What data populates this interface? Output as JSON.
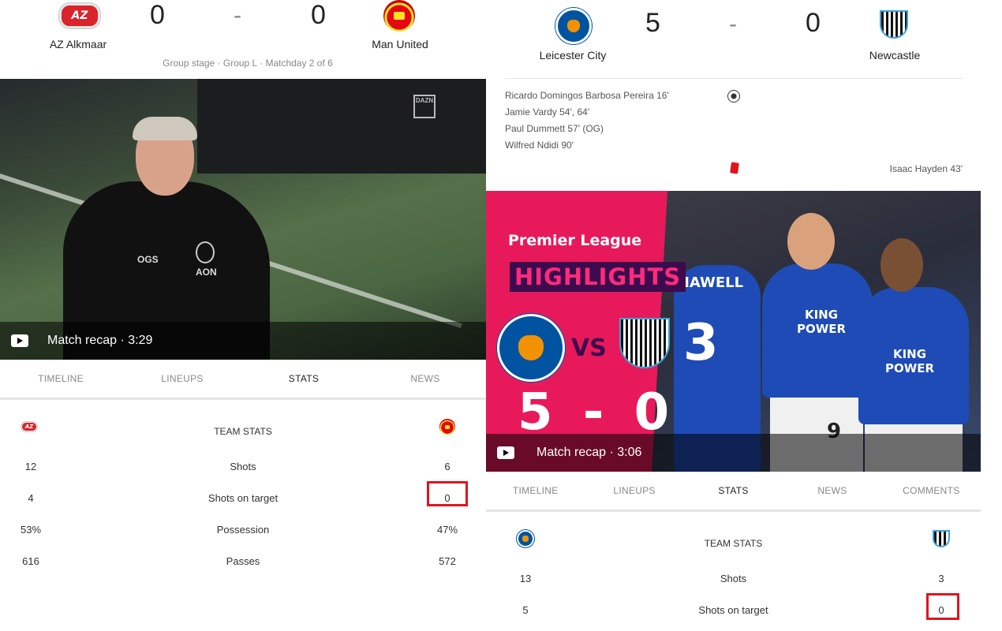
{
  "left": {
    "home_team": "AZ Alkmaar",
    "away_team": "Man United",
    "home_score": "0",
    "away_score": "0",
    "separator": "-",
    "meta": "Group stage · Group L · Matchday 2 of 6",
    "watermark": "DAZN",
    "recap": "Match recap · 3:29",
    "tabs": [
      "TIMELINE",
      "LINEUPS",
      "STATS",
      "NEWS"
    ],
    "active_tab": "STATS",
    "stats_title": "TEAM STATS",
    "stats": [
      {
        "label": "Shots",
        "home": "12",
        "away": "6"
      },
      {
        "label": "Shots on target",
        "home": "4",
        "away": "0"
      },
      {
        "label": "Possession",
        "home": "53%",
        "away": "47%"
      },
      {
        "label": "Passes",
        "home": "616",
        "away": "572"
      }
    ],
    "jersey_initials": "OGS",
    "sponsor": "AON"
  },
  "right": {
    "home_team": "Leicester City",
    "away_team": "Newcastle",
    "home_score": "5",
    "away_score": "0",
    "separator": "-",
    "goals": [
      "Ricardo Domingos Barbosa Pereira 16'",
      "Jamie Vardy 54', 64'",
      "Paul Dummett 57' (OG)",
      "Wilfred Ndidi 90'"
    ],
    "red_card": "Isaac Hayden 43'",
    "graphic": {
      "league": "Premier League",
      "banner": "HIGHLIGHTS",
      "vs": "VS",
      "score": "5 - 0",
      "sponsor": "KING POWER",
      "shirt_name": "MAWELL",
      "shirt_number": "3",
      "shorts_number": "9"
    },
    "recap": "Match recap · 3:06",
    "tabs": [
      "TIMELINE",
      "LINEUPS",
      "STATS",
      "NEWS",
      "COMMENTS"
    ],
    "active_tab": "STATS",
    "stats_title": "TEAM STATS",
    "stats": [
      {
        "label": "Shots",
        "home": "13",
        "away": "3"
      },
      {
        "label": "Shots on target",
        "home": "5",
        "away": "0"
      }
    ]
  },
  "colors": {
    "highlight_box": "#e0141e",
    "graphic_pink": "#e8195a",
    "banner_purple": "#3d0a4e"
  }
}
